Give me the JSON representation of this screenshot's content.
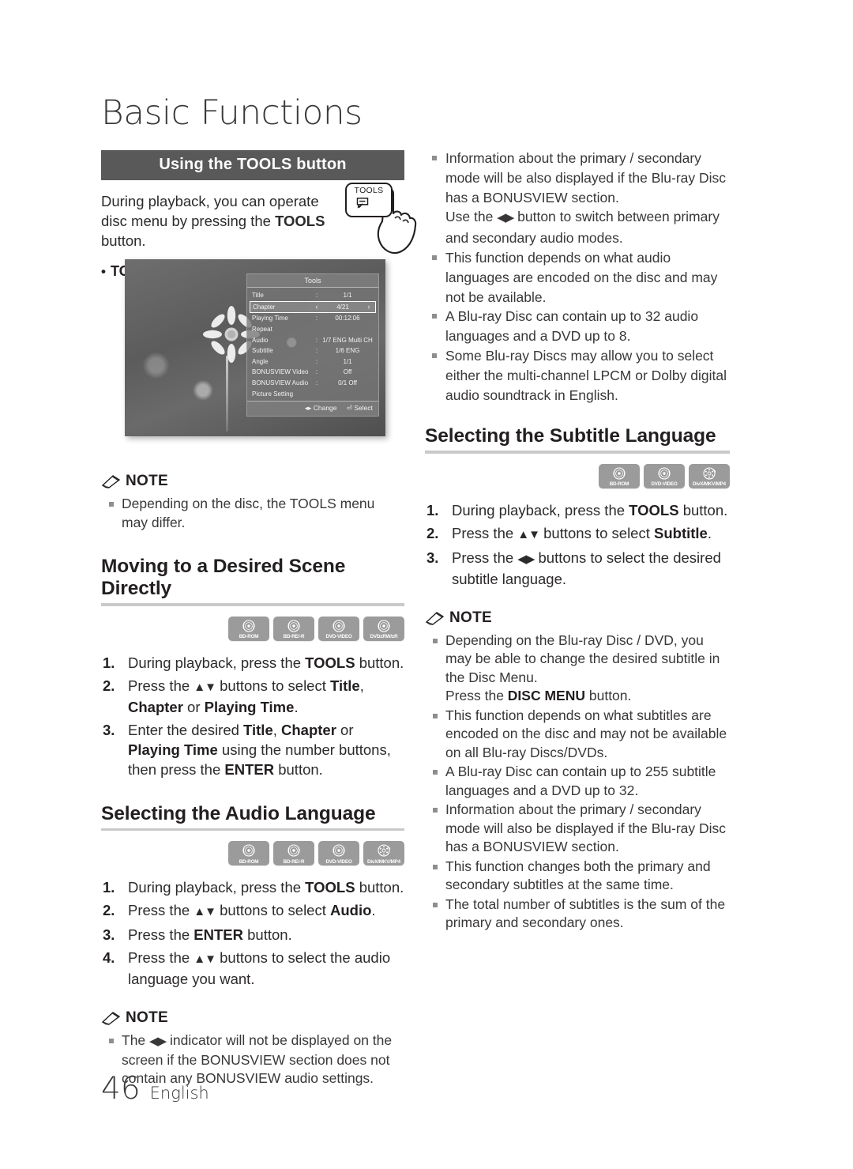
{
  "page": {
    "chapter_title": "Basic Functions",
    "page_number": "46",
    "language": "English"
  },
  "left_column": {
    "section_bar": "Using the TOOLS button",
    "intro_paragraph_part1": "During playback, you can operate disc menu by pressing the ",
    "intro_paragraph_bold": "TOOLS",
    "intro_paragraph_part2": " button.",
    "sub_bullet": "TOOLS Menu Screen",
    "tools_key_label": "TOOLS",
    "tools_menu_screen": {
      "panel_title": "Tools",
      "rows": [
        {
          "label": "Title",
          "colon": ":",
          "value": "1/1",
          "selected": false
        },
        {
          "label": "Chapter",
          "colon": "",
          "value": "4/21",
          "selected": true,
          "left_arrow": "‹",
          "right_arrow": "›"
        },
        {
          "label": "Playing Time",
          "colon": ":",
          "value": "00:12:06",
          "selected": false
        },
        {
          "label": "Repeat",
          "colon": "",
          "value": "",
          "selected": false
        },
        {
          "label": "Audio",
          "colon": ":",
          "value": "1/7 ENG Multi CH",
          "selected": false
        },
        {
          "label": "Subtitle",
          "colon": ":",
          "value": "1/6 ENG",
          "selected": false
        },
        {
          "label": "Angle",
          "colon": ":",
          "value": "1/1",
          "selected": false
        },
        {
          "label": "BONUSVIEW Video",
          "colon": ":",
          "value": "Off",
          "selected": false
        },
        {
          "label": "BONUSVIEW Audio",
          "colon": ":",
          "value": "0/1 Off",
          "selected": false
        },
        {
          "label": "Picture Setting",
          "colon": "",
          "value": "",
          "selected": false
        }
      ],
      "footer_change": "◂▸ Change",
      "footer_select": "⏎ Select"
    },
    "note1": {
      "title": "NOTE",
      "items": [
        "Depending on the disc, the TOOLS menu may differ."
      ]
    },
    "section2": {
      "heading": "Moving to a Desired Scene Directly",
      "discs": [
        "BD-ROM",
        "BD-RE/-R",
        "DVD-VIDEO",
        "DVD±RW/±R"
      ],
      "steps": [
        {
          "num": "1.",
          "html": "During playback, press the <b>TOOLS</b> button."
        },
        {
          "num": "2.",
          "html": "Press the <span class=\"arw\">▲▼</span> buttons to select <b>Title</b>, <b>Chapter</b> or <b>Playing Time</b>."
        },
        {
          "num": "3.",
          "html": "Enter the desired <b>Title</b>, <b>Chapter</b> or <b>Playing Time</b> using the number buttons, then press the <b>ENTER</b> button."
        }
      ]
    },
    "section3": {
      "heading": "Selecting the Audio Language",
      "discs": [
        "BD-ROM",
        "BD-RE/-R",
        "DVD-VIDEO",
        "DivX/MKV/MP4"
      ],
      "steps": [
        {
          "num": "1.",
          "html": "During playback, press the <b>TOOLS</b> button."
        },
        {
          "num": "2.",
          "html": "Press the <span class=\"arw\">▲▼</span> buttons to select <b>Audio</b>."
        },
        {
          "num": "3.",
          "html": "Press the <b>ENTER</b> button."
        },
        {
          "num": "4.",
          "html": "Press the <span class=\"arw\">▲▼</span> buttons to select the audio language you want."
        }
      ]
    },
    "note2": {
      "title": "NOTE",
      "items_html": [
        "The <span class=\"arw\">◀▶</span> indicator will not be displayed on the screen if the BONUSVIEW section does not contain any BONUSVIEW audio settings."
      ]
    }
  },
  "right_column": {
    "top_notes_html": [
      "Information about the primary / secondary mode will be also displayed if the Blu-ray Disc has a BONUSVIEW section.<br>Use the <span class=\"arw\">◀▶</span> button to switch between primary and secondary audio modes.",
      "This function depends on what audio languages are encoded on the disc and may not be available.",
      "A Blu-ray Disc can contain up to 32 audio languages and a DVD up to 8.",
      "Some Blu-ray Discs may allow you to select either the multi-channel LPCM or Dolby digital audio soundtrack in English."
    ],
    "section1": {
      "heading": "Selecting the Subtitle Language",
      "discs": [
        "BD-ROM",
        "DVD-VIDEO",
        "DivX/MKV/MP4"
      ],
      "steps": [
        {
          "num": "1.",
          "html": "During playback, press the <b>TOOLS</b> button."
        },
        {
          "num": "2.",
          "html": "Press the <span class=\"arw\">▲▼</span> buttons to select <b>Subtitle</b>."
        },
        {
          "num": "3.",
          "html": "Press the <span class=\"arw\">◀▶</span> buttons to select the desired subtitle language."
        }
      ]
    },
    "note": {
      "title": "NOTE",
      "items_html": [
        "Depending on the Blu-ray Disc / DVD, you may be able to change the desired subtitle in the Disc Menu.<br>Press the <b>DISC MENU</b> button.",
        "This function depends on what subtitles are encoded on the disc and may not be available on all Blu-ray Discs/DVDs.",
        "A Blu-ray Disc can contain up to 255 subtitle languages and a DVD up to 32.",
        "Information about the primary / secondary mode will also be displayed if the Blu-ray Disc has a BONUSVIEW section.",
        "This function changes both the primary and secondary subtitles at the same time.",
        "The total number of subtitles is the sum of the primary and secondary ones."
      ]
    }
  },
  "colors": {
    "bar_gray": "#595959",
    "rule_gray": "#c9c9c9",
    "disc_gray": "#9b9b9b",
    "text": "#231f20"
  }
}
